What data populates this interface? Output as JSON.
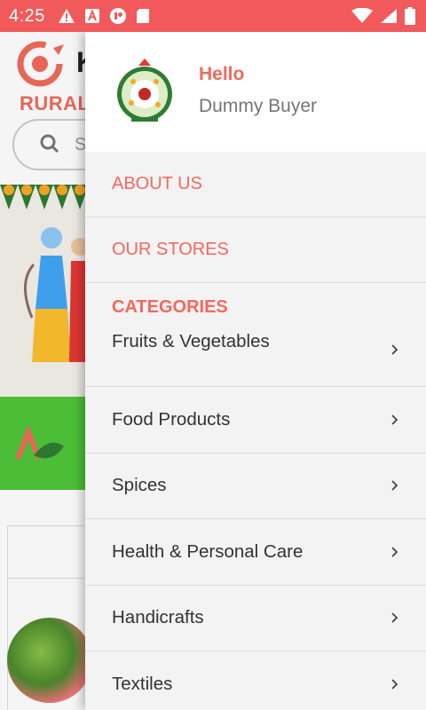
{
  "status_bar": {
    "time": "4:25",
    "icons_left": [
      "warning-icon",
      "a-box-icon",
      "record-icon",
      "sd-card-icon"
    ],
    "icons_right": [
      "wifi-icon",
      "signal-icon",
      "battery-icon"
    ],
    "color": "#f2595a"
  },
  "background": {
    "brand_initial": "K",
    "brand_sub": "RURAL",
    "search_placeholder": "S"
  },
  "drawer": {
    "greeting": "Hello",
    "user_name": "Dummy Buyer",
    "sections": [
      "ABOUT US",
      "OUR STORES"
    ],
    "categories_title": "CATEGORIES",
    "categories": [
      "Fruits & Vegetables",
      "Food Products",
      "Spices",
      "Health & Personal Care",
      "Handicrafts",
      "Textiles"
    ]
  },
  "colors": {
    "accent": "#f2695d",
    "green": "#4fc53a"
  }
}
